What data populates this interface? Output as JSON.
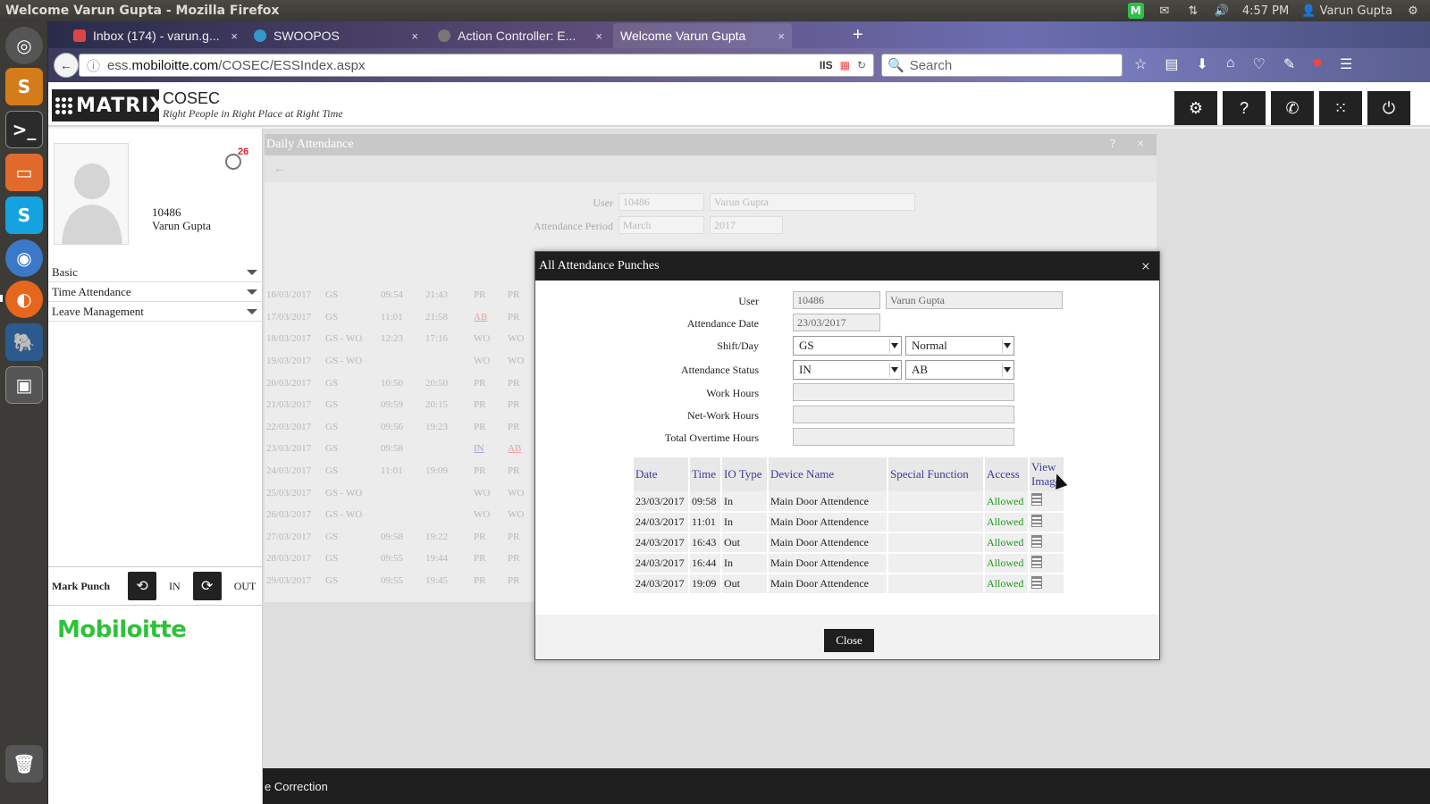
{
  "os": {
    "window_title": "Welcome Varun Gupta - Mozilla Firefox",
    "clock": "4:57 PM",
    "user": "Varun Gupta",
    "indicator_m": "M"
  },
  "browser": {
    "tabs": [
      {
        "label": "Inbox (174) - varun.g...",
        "close": "×"
      },
      {
        "label": "SWOOPOS",
        "close": "×"
      },
      {
        "label": "Action Controller: E...",
        "close": "×"
      },
      {
        "label": "Welcome Varun Gupta",
        "close": "×"
      }
    ],
    "new_tab": "+",
    "url_prefix": "ess.",
    "url_host": "mobiloitte.com",
    "url_path": "/COSEC/ESSIndex.aspx",
    "search_placeholder": "Search"
  },
  "app": {
    "logo_text": "MATRIX",
    "name": "COSEC",
    "tagline": "Right People in Right Place at Right Time"
  },
  "profile": {
    "user_id": "10486",
    "user_name": "Varun Gupta",
    "notification_count": "26"
  },
  "menu": [
    {
      "label": "Basic"
    },
    {
      "label": "Time Attendance"
    },
    {
      "label": "Leave Management"
    }
  ],
  "mark_punch": {
    "label": "Mark Punch",
    "in_label": "IN",
    "out_label": "OUT"
  },
  "brand": "Mobiloitte",
  "bottom_bar": "e Correction",
  "daily": {
    "title": "Daily Attendance",
    "help": "?",
    "close": "×",
    "back": "←",
    "user_label": "User",
    "user_id": "10486",
    "user_name": "Varun Gupta",
    "period_label": "Attendance Period",
    "month": "March",
    "year": "2017",
    "rows": [
      {
        "date": "16/03/2017",
        "shift": "GS",
        "in": "09:54",
        "out": "21:43",
        "s1": "PR",
        "s2": "PR"
      },
      {
        "date": "17/03/2017",
        "shift": "GS",
        "in": "11:01",
        "out": "21:58",
        "s1": "AB",
        "s2": "PR"
      },
      {
        "date": "18/03/2017",
        "shift": "GS - WO",
        "in": "12:23",
        "out": "17:16",
        "s1": "WO",
        "s2": "WO"
      },
      {
        "date": "19/03/2017",
        "shift": "GS - WO",
        "in": "",
        "out": "",
        "s1": "WO",
        "s2": "WO"
      },
      {
        "date": "20/03/2017",
        "shift": "GS",
        "in": "10:50",
        "out": "20:50",
        "s1": "PR",
        "s2": "PR"
      },
      {
        "date": "21/03/2017",
        "shift": "GS",
        "in": "09:59",
        "out": "20:15",
        "s1": "PR",
        "s2": "PR"
      },
      {
        "date": "22/03/2017",
        "shift": "GS",
        "in": "09:56",
        "out": "19:23",
        "s1": "PR",
        "s2": "PR"
      },
      {
        "date": "23/03/2017",
        "shift": "GS",
        "in": "09:58",
        "out": "",
        "s1": "IN",
        "s2": "AB"
      },
      {
        "date": "24/03/2017",
        "shift": "GS",
        "in": "11:01",
        "out": "19:09",
        "s1": "PR",
        "s2": "PR"
      },
      {
        "date": "25/03/2017",
        "shift": "GS - WO",
        "in": "",
        "out": "",
        "s1": "WO",
        "s2": "WO"
      },
      {
        "date": "26/03/2017",
        "shift": "GS - WO",
        "in": "",
        "out": "",
        "s1": "WO",
        "s2": "WO"
      },
      {
        "date": "27/03/2017",
        "shift": "GS",
        "in": "09:58",
        "out": "19:22",
        "s1": "PR",
        "s2": "PR"
      },
      {
        "date": "28/03/2017",
        "shift": "GS",
        "in": "09:55",
        "out": "19:44",
        "s1": "PR",
        "s2": "PR"
      },
      {
        "date": "29/03/2017",
        "shift": "GS",
        "in": "09:55",
        "out": "19:45",
        "s1": "PR",
        "s2": "PR"
      }
    ]
  },
  "modal": {
    "title": "All Attendance Punches",
    "close_x": "×",
    "fields": {
      "user_label": "User",
      "user_id": "10486",
      "user_name": "Varun Gupta",
      "date_label": "Attendance Date",
      "date_value": "23/03/2017",
      "shift_label": "Shift/Day",
      "shift_value": "GS",
      "day_value": "Normal",
      "status_label": "Attendance Status",
      "status_first": "IN",
      "status_second": "AB",
      "work_hours_label": "Work Hours",
      "net_work_hours_label": "Net-Work Hours",
      "overtime_label": "Total Overtime Hours"
    },
    "table": {
      "headers": [
        "Date",
        "Time",
        "IO Type",
        "Device Name",
        "Special Function",
        "Access",
        "View Image"
      ],
      "rows": [
        {
          "date": "23/03/2017",
          "time": "09:58",
          "io": "In",
          "device": "Main Door Attendence",
          "special": "",
          "access": "Allowed"
        },
        {
          "date": "24/03/2017",
          "time": "11:01",
          "io": "In",
          "device": "Main Door Attendence",
          "special": "",
          "access": "Allowed"
        },
        {
          "date": "24/03/2017",
          "time": "16:43",
          "io": "Out",
          "device": "Main Door Attendence",
          "special": "",
          "access": "Allowed"
        },
        {
          "date": "24/03/2017",
          "time": "16:44",
          "io": "In",
          "device": "Main Door Attendence",
          "special": "",
          "access": "Allowed"
        },
        {
          "date": "24/03/2017",
          "time": "19:09",
          "io": "Out",
          "device": "Main Door Attendence",
          "special": "",
          "access": "Allowed"
        }
      ]
    },
    "close_button": "Close"
  },
  "colors": {
    "allowed": "#1d9a1d",
    "brand_green": "#2ec23a",
    "header_dark": "#1e1e1e",
    "table_header_text": "#3a3a9a"
  }
}
